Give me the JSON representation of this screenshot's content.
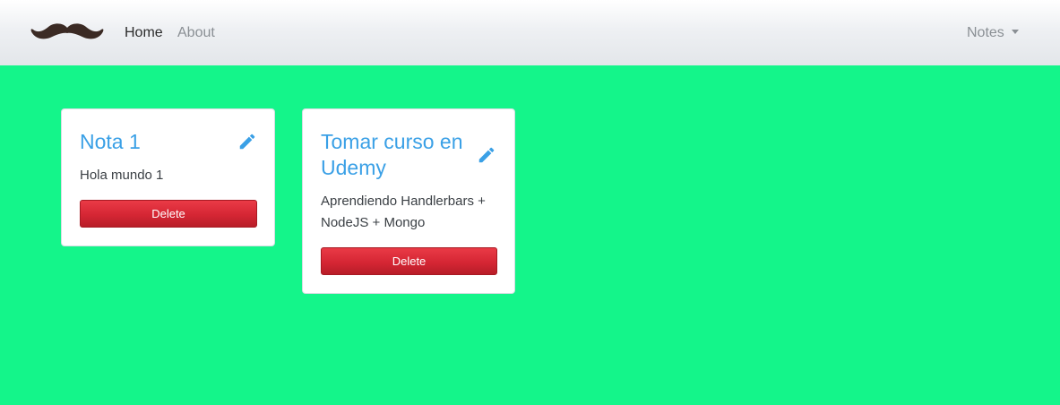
{
  "navbar": {
    "brand_icon": "mustache-icon",
    "links": [
      {
        "label": "Home",
        "active": true
      },
      {
        "label": "About",
        "active": false
      }
    ],
    "notes_dropdown": {
      "label": "Notes"
    }
  },
  "notes": [
    {
      "title": "Nota 1",
      "description": "Hola mundo 1",
      "delete_label": "Delete",
      "edit_icon": "pencil-icon"
    },
    {
      "title": "Tomar curso en Udemy",
      "description": "Aprendiendo Handlerbars + NodeJS + Mongo",
      "delete_label": "Delete",
      "edit_icon": "pencil-icon"
    }
  ],
  "colors": {
    "page_background": "#14f58a",
    "title": "#3aa0e6",
    "delete_button": "#d52634",
    "brand": "#3b2a24"
  }
}
